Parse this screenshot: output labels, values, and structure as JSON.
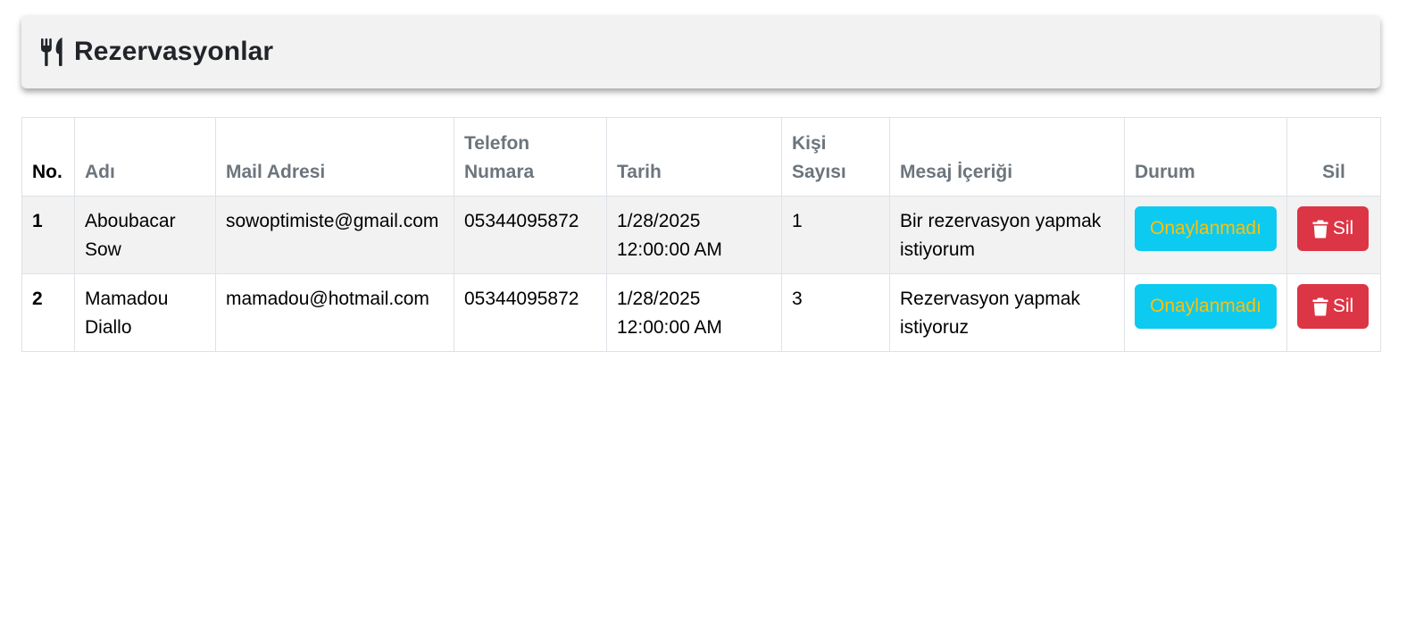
{
  "page": {
    "title": "Rezervasyonlar",
    "title_icon": "utensils-icon"
  },
  "table": {
    "headers": {
      "no": "No.",
      "name": "Adı",
      "email": "Mail Adresi",
      "phone": "Telefon Numara",
      "date": "Tarih",
      "guests": "Kişi Sayısı",
      "message": "Mesaj İçeriği",
      "status": "Durum",
      "delete": "Sil"
    },
    "rows": [
      {
        "no": "1",
        "name": "Aboubacar Sow",
        "email": "sowoptimiste@gmail.com",
        "phone": "05344095872",
        "date": "1/28/2025 12:00:00 AM",
        "guests": "1",
        "message": "Bir rezervasyon yapmak istiyorum",
        "status": "Onaylanmadı",
        "delete": "Sil"
      },
      {
        "no": "2",
        "name": "Mamadou Diallo",
        "email": "mamadou@hotmail.com",
        "phone": "05344095872",
        "date": "1/28/2025 12:00:00 AM",
        "guests": "3",
        "message": "Rezervasyon yapmak istiyoruz",
        "status": "Onaylanmadı",
        "delete": "Sil"
      }
    ]
  },
  "colors": {
    "status_button_bg": "#0dcaf0",
    "status_button_text": "#ffc107",
    "delete_button_bg": "#dc3545",
    "delete_button_text": "#ffffff",
    "header_card_bg": "#f2f2f2",
    "header_text_muted": "#6c757d"
  },
  "icons": {
    "delete": "trash-icon"
  }
}
